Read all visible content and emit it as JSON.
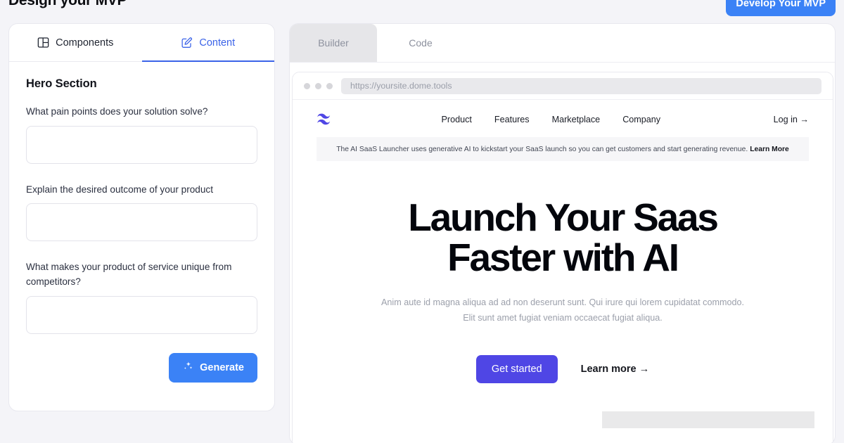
{
  "header": {
    "title": "Design your MVP",
    "cta_label": "Develop Your MVP"
  },
  "editor_panel": {
    "tabs": [
      {
        "label": "Components",
        "icon": "layout-panels-icon",
        "active": false
      },
      {
        "label": "Content",
        "icon": "pencil-square-icon",
        "active": true
      }
    ],
    "section_title": "Hero Section",
    "fields": [
      {
        "label": "What pain points does your solution solve?",
        "value": "",
        "placeholder": ""
      },
      {
        "label": "Explain the desired outcome of your product",
        "value": "",
        "placeholder": ""
      },
      {
        "label": "What makes your product of service unique from competitors?",
        "value": "",
        "placeholder": ""
      }
    ],
    "generate_label": "Generate",
    "generate_icon": "sparkles-icon"
  },
  "preview_panel": {
    "modes": [
      {
        "label": "Builder",
        "active": true
      },
      {
        "label": "Code",
        "active": false
      }
    ],
    "browser": {
      "url": "https://yoursite.dome.tools",
      "traffic_lights": 3
    },
    "site": {
      "logo_icon": "wave-logo-icon",
      "nav_links": [
        "Product",
        "Features",
        "Marketplace",
        "Company"
      ],
      "login_label": "Log in",
      "login_arrow": "→",
      "banner_text": "The AI SaaS Launcher uses generative AI to kickstart your SaaS launch so you can get customers and start generating revenue.",
      "banner_link": "Learn More",
      "headline_line1": "Launch Your Saas",
      "headline_line2": "Faster with AI",
      "subtext_line1": "Anim aute id magna aliqua ad ad non deserunt sunt. Qui irure qui lorem cupidatat commodo.",
      "subtext_line2": "Elit sunt amet fugiat veniam occaecat fugiat aliqua.",
      "primary_cta": "Get started",
      "secondary_cta": "Learn more →"
    }
  },
  "colors": {
    "page_background": "#f4f4f8",
    "accent_blue": "#3b82f6",
    "tab_active_blue": "#3b63e8",
    "hero_indigo": "#4f46e5",
    "logo_purple": "#4f46e5"
  }
}
